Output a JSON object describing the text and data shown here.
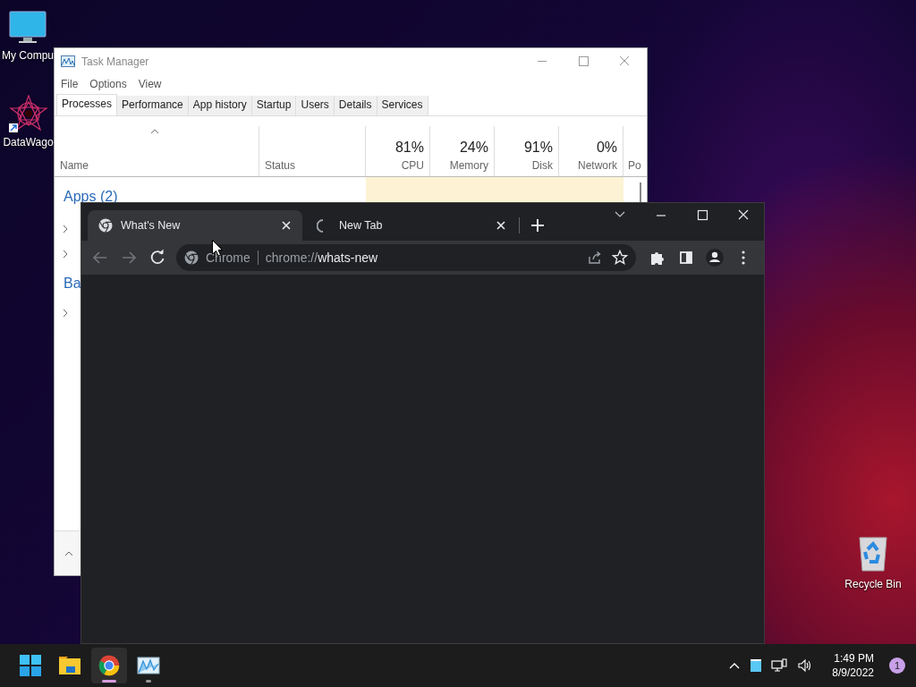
{
  "desktop": {
    "icons": [
      {
        "kind": "computer",
        "label": "My Compu"
      },
      {
        "kind": "shortcut",
        "label": "DataWago"
      },
      {
        "kind": "recycle",
        "label": "Recycle Bin"
      }
    ]
  },
  "task_manager": {
    "title": "Task Manager",
    "menu": [
      "File",
      "Options",
      "View"
    ],
    "tabs": [
      {
        "label": "Processes",
        "selected": true
      },
      {
        "label": "Performance",
        "selected": false
      },
      {
        "label": "App history",
        "selected": false
      },
      {
        "label": "Startup",
        "selected": false
      },
      {
        "label": "Users",
        "selected": false
      },
      {
        "label": "Details",
        "selected": false
      },
      {
        "label": "Services",
        "selected": false
      }
    ],
    "columns": [
      {
        "label": "Name"
      },
      {
        "label": "Status"
      },
      {
        "value": "81%",
        "label": "CPU"
      },
      {
        "value": "24%",
        "label": "Memory"
      },
      {
        "value": "91%",
        "label": "Disk"
      },
      {
        "value": "0%",
        "label": "Network"
      },
      {
        "label": "Po"
      }
    ],
    "groups": [
      {
        "label": "Apps (2)",
        "rows": [
          {
            "expanded": false
          },
          {
            "expanded": false
          }
        ]
      },
      {
        "label": "Ba",
        "rows": [
          {
            "expanded": false
          }
        ]
      }
    ]
  },
  "browser": {
    "tabs": [
      {
        "title": "What's New",
        "selected": true,
        "loading": false
      },
      {
        "title": "New Tab",
        "selected": false,
        "loading": true
      }
    ],
    "address": {
      "origin": "Chrome",
      "url": "chrome://**whats-new**"
    }
  },
  "taskbar": {
    "apps": [
      {
        "kind": "start",
        "running": false,
        "selected": false
      },
      {
        "kind": "explorer",
        "running": false,
        "selected": false
      },
      {
        "kind": "chrome",
        "running": true,
        "selected": true
      },
      {
        "kind": "taskmgr",
        "running": true,
        "selected": false
      }
    ],
    "clock": {
      "time": "1:49 PM",
      "date": "8/9/2022"
    },
    "notifications": "1"
  }
}
